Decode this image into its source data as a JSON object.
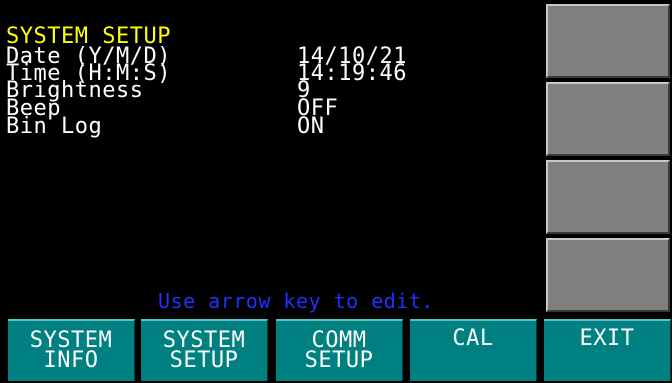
{
  "screen": {
    "title": "SYSTEM SETUP",
    "rows": [
      {
        "label": "Date (Y/M/D)",
        "value": "14/10/21"
      },
      {
        "label": "Time (H:M:S)",
        "value": "14:19:46"
      },
      {
        "label": "Brightness",
        "value": "9"
      },
      {
        "label": "Beep",
        "value": "OFF"
      },
      {
        "label": "Bin Log",
        "value": "ON"
      }
    ],
    "hint": "Use arrow key to edit."
  },
  "softkeys": [
    {
      "line1": "SYSTEM",
      "line2": "INFO"
    },
    {
      "line1": "SYSTEM",
      "line2": "SETUP"
    },
    {
      "line1": "COMM",
      "line2": "SETUP"
    },
    {
      "line1": "CAL",
      "line2": ""
    },
    {
      "line1": "EXIT",
      "line2": ""
    }
  ],
  "colors": {
    "title": "#ffff00",
    "text": "#ffffff",
    "hint": "#2030ff",
    "softkey_bg": "#008080",
    "side_button_bg": "#7f7f7f",
    "background": "#000000"
  }
}
